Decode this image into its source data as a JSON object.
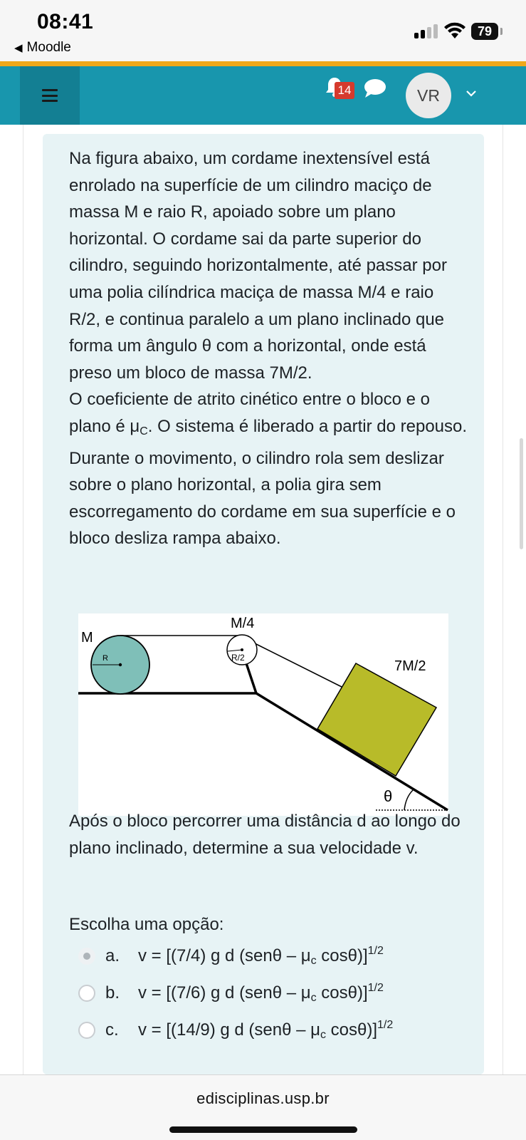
{
  "status_bar": {
    "time": "08:41",
    "back_label": "Moodle",
    "battery": "79"
  },
  "navbar": {
    "notifications_count": "14",
    "avatar_initials": "VR",
    "accent_color": "#f0a81a",
    "bar_color": "#1896ad"
  },
  "question": {
    "paragraph1": "Na figura abaixo, um cordame inextensível está enrolado na superfície de um cilindro maciço de massa M e raio R, apoiado sobre um plano horizontal. O cordame sai da parte superior do cilindro, seguindo horizontalmente, até passar por uma polia cilíndrica maciça de massa M/4 e raio R/2, e continua paralelo a um plano inclinado que forma um ângulo θ com a horizontal, onde está preso um bloco de massa 7M/2.",
    "paragraph2_pre": "O coeficiente de atrito cinético entre o bloco e o plano é μ",
    "paragraph2_sub": "C",
    "paragraph2_post": ". O sistema é liberado a partir do repouso. Durante o movimento, o cilindro rola sem deslizar sobre o plano horizontal, a polia gira sem escorregamento do cordame em sua superfície e o bloco desliza rampa abaixo.",
    "after_figure": "Após o bloco percorrer uma distância d ao longo do plano inclinado, determine a sua velocidade v.",
    "prompt": "Escolha uma opção:"
  },
  "figure": {
    "label_M": "M",
    "label_R": "R",
    "label_pulley_mass": "M/4",
    "label_pulley_radius": "R/2",
    "label_block": "7M/2",
    "label_angle": "θ",
    "cylinder_color": "#7fbfb8",
    "block_color": "#b8bb29"
  },
  "options": [
    {
      "letter": "a.",
      "pre": "v = [(7/4) g d (senθ – μ",
      "sub": "c",
      "post": " cosθ)]",
      "sup": "1/2"
    },
    {
      "letter": "b.",
      "pre": "v = [(7/6) g d (senθ – μ",
      "sub": "c",
      "post": " cosθ)]",
      "sup": "1/2"
    },
    {
      "letter": "c.",
      "pre": "v = [(14/9) g d (senθ – μ",
      "sub": "c",
      "post": " cosθ)]",
      "sup": "1/2"
    }
  ],
  "footer": {
    "url": "edisciplinas.usp.br"
  }
}
